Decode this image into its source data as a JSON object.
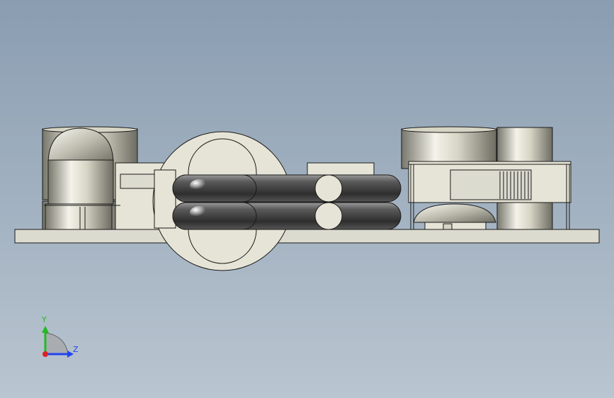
{
  "viewport": {
    "background_top": "#8a9db1",
    "background_bottom": "#b9c5d0"
  },
  "model": {
    "description_icon": "pcb-assembly-side-view",
    "colors": {
      "board": "#dcdbd0",
      "component_light": "#e6e4d6",
      "metal_highlight": "#f4f3ea",
      "metal_shadow": "#77766b",
      "tube_dark": "#3a3a3a",
      "outline": "#1a1a1a"
    }
  },
  "triad": {
    "y_label": "Y",
    "z_label": "Z",
    "y_color": "#22bb22",
    "z_color": "#2244ee",
    "x_color": "#dd2222",
    "icon": "coordinate-triad-icon"
  }
}
